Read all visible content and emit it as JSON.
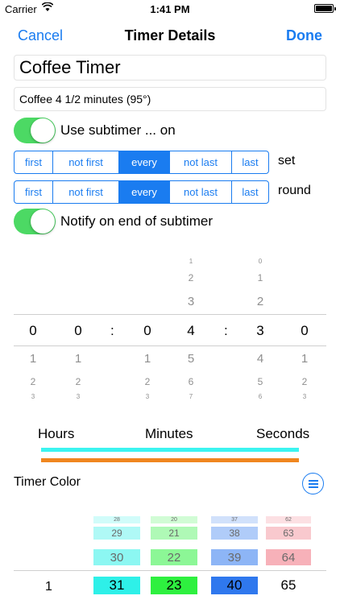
{
  "status_bar": {
    "carrier": "Carrier",
    "time": "1:41 PM"
  },
  "nav": {
    "cancel": "Cancel",
    "title": "Timer Details",
    "done": "Done"
  },
  "timer": {
    "name": "Coffee Timer",
    "description": "Coffee 4 1/2 minutes (95°)"
  },
  "subtimer": {
    "toggle_label": "Use subtimer ... on",
    "enabled": true
  },
  "set_segment": {
    "options": [
      "first",
      "not first",
      "every",
      "not last",
      "last"
    ],
    "selected": "every",
    "label": "set"
  },
  "round_segment": {
    "options": [
      "first",
      "not first",
      "every",
      "not last",
      "last"
    ],
    "selected": "every",
    "label": "round"
  },
  "notify": {
    "toggle_label": "Notify on end of subtimer",
    "enabled": true
  },
  "time_picker": {
    "columns": [
      {
        "above": [],
        "selected": "0",
        "below": [
          "1",
          "2",
          "3"
        ]
      },
      {
        "above": [],
        "selected": "0",
        "below": [
          "1",
          "2",
          "3"
        ]
      },
      {
        "above": [],
        "selected": "0",
        "below": [
          "1",
          "2",
          "3"
        ]
      },
      {
        "above": [
          "1",
          "2",
          "3"
        ],
        "selected": "4",
        "below": [
          "5",
          "6",
          "7"
        ]
      },
      {
        "above": [
          "0",
          "1",
          "2"
        ],
        "selected": "3",
        "below": [
          "4",
          "5",
          "6"
        ]
      },
      {
        "above": [],
        "selected": "0",
        "below": [
          "1",
          "2",
          "3"
        ]
      }
    ],
    "separator": ":",
    "unit_labels": {
      "hours": "Hours",
      "minutes": "Minutes",
      "seconds": "Seconds"
    }
  },
  "progress_bars": [
    {
      "color": "#3cf4f0",
      "fraction": 1.0
    },
    {
      "color": "#f0861f",
      "fraction": 1.0
    }
  ],
  "timer_color": {
    "title": "Timer Color",
    "row_label": "1",
    "columns": [
      {
        "values": [
          "28",
          "29",
          "30",
          "31"
        ],
        "color": "#2ef0e8"
      },
      {
        "values": [
          "20",
          "21",
          "22",
          "23"
        ],
        "color": "#2ef03f"
      },
      {
        "values": [
          "37",
          "38",
          "39",
          "40"
        ],
        "color": "#2f78ee"
      },
      {
        "values": [
          "62",
          "63",
          "64",
          "65"
        ],
        "color": "#f0717f"
      }
    ]
  },
  "colors": {
    "accent": "#1a7cf0",
    "switch_on": "#4cd964"
  }
}
